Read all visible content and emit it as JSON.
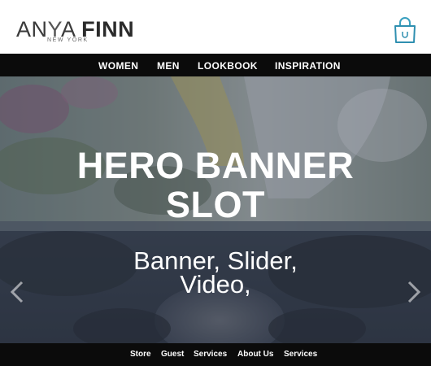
{
  "brand": {
    "name_part1": "AN",
    "name_part2": "Y",
    "name_part3": "A",
    "name_part4": "FINN",
    "tagline": "NEW YORK"
  },
  "header": {
    "cart_icon": "shopping-bag-icon"
  },
  "main_nav": {
    "items": [
      {
        "label": "WOMEN"
      },
      {
        "label": "MEN"
      },
      {
        "label": "LOOKBOOK"
      },
      {
        "label": "INSPIRATION"
      }
    ]
  },
  "hero": {
    "title_line1": "HERO BANNER",
    "title_line2": "SLOT",
    "subtitle_line1": "Banner,  Slider,",
    "subtitle_line2": "Video,",
    "prev_icon": "chevron-left-icon",
    "next_icon": "chevron-right-icon"
  },
  "footer_nav": {
    "items": [
      {
        "label": "Store"
      },
      {
        "label": "Guest"
      },
      {
        "label": "Services"
      },
      {
        "label": "About Us"
      },
      {
        "label": "Services"
      }
    ]
  },
  "colors": {
    "nav_background": "#0b0b0b",
    "hero_overlay": "#3c4656",
    "text_light": "#ffffff"
  }
}
